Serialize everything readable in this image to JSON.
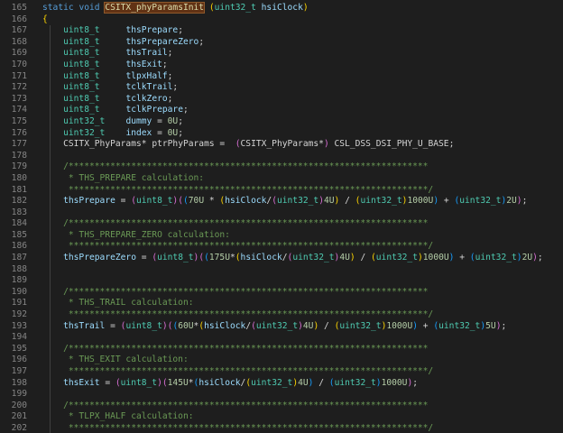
{
  "editor": {
    "lines": [
      {
        "n": "165",
        "toks": [
          {
            "t": "static",
            "c": "kw"
          },
          {
            "t": " ",
            "c": "pl"
          },
          {
            "t": "void",
            "c": "kw"
          },
          {
            "t": " ",
            "c": "pl"
          },
          {
            "t": "CSITX_phyParamsInit",
            "c": "fn",
            "hl": true
          },
          {
            "t": " ",
            "c": "pl"
          },
          {
            "t": "(",
            "c": "br"
          },
          {
            "t": "uint32_t",
            "c": "ty"
          },
          {
            "t": " ",
            "c": "pl"
          },
          {
            "t": "hsiClock",
            "c": "va"
          },
          {
            "t": ")",
            "c": "br"
          }
        ]
      },
      {
        "n": "166",
        "toks": [
          {
            "t": "{",
            "c": "br"
          }
        ]
      },
      {
        "n": "167",
        "toks": [
          {
            "t": "    ",
            "c": "pl"
          },
          {
            "t": "uint8_t",
            "c": "ty"
          },
          {
            "t": "     ",
            "c": "pl"
          },
          {
            "t": "thsPrepare",
            "c": "va"
          },
          {
            "t": ";",
            "c": "pl"
          }
        ]
      },
      {
        "n": "168",
        "toks": [
          {
            "t": "    ",
            "c": "pl"
          },
          {
            "t": "uint8_t",
            "c": "ty"
          },
          {
            "t": "     ",
            "c": "pl"
          },
          {
            "t": "thsPrepareZero",
            "c": "va"
          },
          {
            "t": ";",
            "c": "pl"
          }
        ]
      },
      {
        "n": "169",
        "toks": [
          {
            "t": "    ",
            "c": "pl"
          },
          {
            "t": "uint8_t",
            "c": "ty"
          },
          {
            "t": "     ",
            "c": "pl"
          },
          {
            "t": "thsTrail",
            "c": "va"
          },
          {
            "t": ";",
            "c": "pl"
          }
        ]
      },
      {
        "n": "170",
        "toks": [
          {
            "t": "    ",
            "c": "pl"
          },
          {
            "t": "uint8_t",
            "c": "ty"
          },
          {
            "t": "     ",
            "c": "pl"
          },
          {
            "t": "thsExit",
            "c": "va"
          },
          {
            "t": ";",
            "c": "pl"
          }
        ]
      },
      {
        "n": "171",
        "toks": [
          {
            "t": "    ",
            "c": "pl"
          },
          {
            "t": "uint8_t",
            "c": "ty"
          },
          {
            "t": "     ",
            "c": "pl"
          },
          {
            "t": "tlpxHalf",
            "c": "va"
          },
          {
            "t": ";",
            "c": "pl"
          }
        ]
      },
      {
        "n": "172",
        "toks": [
          {
            "t": "    ",
            "c": "pl"
          },
          {
            "t": "uint8_t",
            "c": "ty"
          },
          {
            "t": "     ",
            "c": "pl"
          },
          {
            "t": "tclkTrail",
            "c": "va"
          },
          {
            "t": ";",
            "c": "pl"
          }
        ]
      },
      {
        "n": "173",
        "toks": [
          {
            "t": "    ",
            "c": "pl"
          },
          {
            "t": "uint8_t",
            "c": "ty"
          },
          {
            "t": "     ",
            "c": "pl"
          },
          {
            "t": "tclkZero",
            "c": "va"
          },
          {
            "t": ";",
            "c": "pl"
          }
        ]
      },
      {
        "n": "174",
        "toks": [
          {
            "t": "    ",
            "c": "pl"
          },
          {
            "t": "uint8_t",
            "c": "ty"
          },
          {
            "t": "     ",
            "c": "pl"
          },
          {
            "t": "tclkPrepare",
            "c": "va"
          },
          {
            "t": ";",
            "c": "pl"
          }
        ]
      },
      {
        "n": "175",
        "toks": [
          {
            "t": "    ",
            "c": "pl"
          },
          {
            "t": "uint32_t",
            "c": "ty"
          },
          {
            "t": "    ",
            "c": "pl"
          },
          {
            "t": "dummy",
            "c": "va"
          },
          {
            "t": " = ",
            "c": "pl"
          },
          {
            "t": "0U",
            "c": "nu"
          },
          {
            "t": ";",
            "c": "pl"
          }
        ]
      },
      {
        "n": "176",
        "toks": [
          {
            "t": "    ",
            "c": "pl"
          },
          {
            "t": "uint32_t",
            "c": "ty"
          },
          {
            "t": "    ",
            "c": "pl"
          },
          {
            "t": "index",
            "c": "va"
          },
          {
            "t": " = ",
            "c": "pl"
          },
          {
            "t": "0U",
            "c": "nu"
          },
          {
            "t": ";",
            "c": "pl"
          }
        ]
      },
      {
        "n": "177",
        "toks": [
          {
            "t": "    ",
            "c": "pl"
          },
          {
            "t": "CSITX_PhyParams",
            "c": "pl"
          },
          {
            "t": "* ",
            "c": "pl"
          },
          {
            "t": "ptrPhyParams",
            "c": "pl"
          },
          {
            "t": " =  ",
            "c": "pl"
          },
          {
            "t": "(",
            "c": "bp"
          },
          {
            "t": "CSITX_PhyParams",
            "c": "pl"
          },
          {
            "t": "*",
            "c": "pl"
          },
          {
            "t": ")",
            "c": "bp"
          },
          {
            "t": " CSL_DSS_DSI_PHY_U_BASE;",
            "c": "pl"
          }
        ]
      },
      {
        "n": "178",
        "toks": []
      },
      {
        "n": "179",
        "toks": [
          {
            "t": "    ",
            "c": "pl"
          },
          {
            "t": "/*********************************************************************",
            "c": "cm"
          }
        ]
      },
      {
        "n": "180",
        "toks": [
          {
            "t": "     * THS_PREPARE calculation:",
            "c": "cm"
          }
        ]
      },
      {
        "n": "181",
        "toks": [
          {
            "t": "     *********************************************************************/",
            "c": "cm"
          }
        ]
      },
      {
        "n": "182",
        "toks": [
          {
            "t": "    ",
            "c": "pl"
          },
          {
            "t": "thsPrepare",
            "c": "va"
          },
          {
            "t": " = ",
            "c": "pl"
          },
          {
            "t": "(",
            "c": "bp"
          },
          {
            "t": "uint8_t",
            "c": "ty"
          },
          {
            "t": ")",
            "c": "bp"
          },
          {
            "t": "(",
            "c": "bp"
          },
          {
            "t": "(",
            "c": "bb"
          },
          {
            "t": "70U",
            "c": "nu"
          },
          {
            "t": " * ",
            "c": "pl"
          },
          {
            "t": "(",
            "c": "br"
          },
          {
            "t": "hsiClock",
            "c": "va"
          },
          {
            "t": "/",
            "c": "pl"
          },
          {
            "t": "(",
            "c": "bp"
          },
          {
            "t": "uint32_t",
            "c": "ty"
          },
          {
            "t": ")",
            "c": "bp"
          },
          {
            "t": "4U",
            "c": "nu"
          },
          {
            "t": ")",
            "c": "br"
          },
          {
            "t": " / ",
            "c": "pl"
          },
          {
            "t": "(",
            "c": "br"
          },
          {
            "t": "uint32_t",
            "c": "ty"
          },
          {
            "t": ")",
            "c": "br"
          },
          {
            "t": "1000U",
            "c": "nu"
          },
          {
            "t": ")",
            "c": "bb"
          },
          {
            "t": " + ",
            "c": "pl"
          },
          {
            "t": "(",
            "c": "bb"
          },
          {
            "t": "uint32_t",
            "c": "ty"
          },
          {
            "t": ")",
            "c": "bb"
          },
          {
            "t": "2U",
            "c": "nu"
          },
          {
            "t": ")",
            "c": "bp"
          },
          {
            "t": ";",
            "c": "pl"
          }
        ]
      },
      {
        "n": "183",
        "toks": []
      },
      {
        "n": "184",
        "toks": [
          {
            "t": "    ",
            "c": "pl"
          },
          {
            "t": "/*********************************************************************",
            "c": "cm"
          }
        ]
      },
      {
        "n": "185",
        "toks": [
          {
            "t": "     * THS_PREPARE_ZERO calculation:",
            "c": "cm"
          }
        ]
      },
      {
        "n": "186",
        "toks": [
          {
            "t": "     *********************************************************************/",
            "c": "cm"
          }
        ]
      },
      {
        "n": "187",
        "toks": [
          {
            "t": "    ",
            "c": "pl"
          },
          {
            "t": "thsPrepareZero",
            "c": "va"
          },
          {
            "t": " = ",
            "c": "pl"
          },
          {
            "t": "(",
            "c": "bp"
          },
          {
            "t": "uint8_t",
            "c": "ty"
          },
          {
            "t": ")",
            "c": "bp"
          },
          {
            "t": "(",
            "c": "bp"
          },
          {
            "t": "(",
            "c": "bb"
          },
          {
            "t": "175U",
            "c": "nu"
          },
          {
            "t": "*",
            "c": "pl"
          },
          {
            "t": "(",
            "c": "br"
          },
          {
            "t": "hsiClock",
            "c": "va"
          },
          {
            "t": "/",
            "c": "pl"
          },
          {
            "t": "(",
            "c": "bp"
          },
          {
            "t": "uint32_t",
            "c": "ty"
          },
          {
            "t": ")",
            "c": "bp"
          },
          {
            "t": "4U",
            "c": "nu"
          },
          {
            "t": ")",
            "c": "br"
          },
          {
            "t": " / ",
            "c": "pl"
          },
          {
            "t": "(",
            "c": "br"
          },
          {
            "t": "uint32_t",
            "c": "ty"
          },
          {
            "t": ")",
            "c": "br"
          },
          {
            "t": "1000U",
            "c": "nu"
          },
          {
            "t": ")",
            "c": "bb"
          },
          {
            "t": " + ",
            "c": "pl"
          },
          {
            "t": "(",
            "c": "bb"
          },
          {
            "t": "uint32_t",
            "c": "ty"
          },
          {
            "t": ")",
            "c": "bb"
          },
          {
            "t": "2U",
            "c": "nu"
          },
          {
            "t": ")",
            "c": "bp"
          },
          {
            "t": ";",
            "c": "pl"
          }
        ]
      },
      {
        "n": "188",
        "toks": []
      },
      {
        "n": "189",
        "toks": []
      },
      {
        "n": "190",
        "toks": [
          {
            "t": "    ",
            "c": "pl"
          },
          {
            "t": "/*********************************************************************",
            "c": "cm"
          }
        ]
      },
      {
        "n": "191",
        "toks": [
          {
            "t": "     * THS_TRAIL calculation:",
            "c": "cm"
          }
        ]
      },
      {
        "n": "192",
        "toks": [
          {
            "t": "     *********************************************************************/",
            "c": "cm"
          }
        ]
      },
      {
        "n": "193",
        "toks": [
          {
            "t": "    ",
            "c": "pl"
          },
          {
            "t": "thsTrail",
            "c": "va"
          },
          {
            "t": " = ",
            "c": "pl"
          },
          {
            "t": "(",
            "c": "bp"
          },
          {
            "t": "uint8_t",
            "c": "ty"
          },
          {
            "t": ")",
            "c": "bp"
          },
          {
            "t": "(",
            "c": "bp"
          },
          {
            "t": "(",
            "c": "bb"
          },
          {
            "t": "60U",
            "c": "nu"
          },
          {
            "t": "*",
            "c": "pl"
          },
          {
            "t": "(",
            "c": "br"
          },
          {
            "t": "hsiClock",
            "c": "va"
          },
          {
            "t": "/",
            "c": "pl"
          },
          {
            "t": "(",
            "c": "bp"
          },
          {
            "t": "uint32_t",
            "c": "ty"
          },
          {
            "t": ")",
            "c": "bp"
          },
          {
            "t": "4U",
            "c": "nu"
          },
          {
            "t": ")",
            "c": "br"
          },
          {
            "t": " / ",
            "c": "pl"
          },
          {
            "t": "(",
            "c": "br"
          },
          {
            "t": "uint32_t",
            "c": "ty"
          },
          {
            "t": ")",
            "c": "br"
          },
          {
            "t": "1000U",
            "c": "nu"
          },
          {
            "t": ")",
            "c": "bb"
          },
          {
            "t": " + ",
            "c": "pl"
          },
          {
            "t": "(",
            "c": "bb"
          },
          {
            "t": "uint32_t",
            "c": "ty"
          },
          {
            "t": ")",
            "c": "bb"
          },
          {
            "t": "5U",
            "c": "nu"
          },
          {
            "t": ")",
            "c": "bp"
          },
          {
            "t": ";",
            "c": "pl"
          }
        ]
      },
      {
        "n": "194",
        "toks": []
      },
      {
        "n": "195",
        "toks": [
          {
            "t": "    ",
            "c": "pl"
          },
          {
            "t": "/*********************************************************************",
            "c": "cm"
          }
        ]
      },
      {
        "n": "196",
        "toks": [
          {
            "t": "     * THS_EXIT calculation:",
            "c": "cm"
          }
        ]
      },
      {
        "n": "197",
        "toks": [
          {
            "t": "     *********************************************************************/",
            "c": "cm"
          }
        ]
      },
      {
        "n": "198",
        "toks": [
          {
            "t": "    ",
            "c": "pl"
          },
          {
            "t": "thsExit",
            "c": "va"
          },
          {
            "t": " = ",
            "c": "pl"
          },
          {
            "t": "(",
            "c": "bp"
          },
          {
            "t": "uint8_t",
            "c": "ty"
          },
          {
            "t": ")",
            "c": "bp"
          },
          {
            "t": "(",
            "c": "bp"
          },
          {
            "t": "145U",
            "c": "nu"
          },
          {
            "t": "*",
            "c": "pl"
          },
          {
            "t": "(",
            "c": "bb"
          },
          {
            "t": "hsiClock",
            "c": "va"
          },
          {
            "t": "/",
            "c": "pl"
          },
          {
            "t": "(",
            "c": "br"
          },
          {
            "t": "uint32_t",
            "c": "ty"
          },
          {
            "t": ")",
            "c": "br"
          },
          {
            "t": "4U",
            "c": "nu"
          },
          {
            "t": ")",
            "c": "bb"
          },
          {
            "t": " / ",
            "c": "pl"
          },
          {
            "t": "(",
            "c": "bb"
          },
          {
            "t": "uint32_t",
            "c": "ty"
          },
          {
            "t": ")",
            "c": "bb"
          },
          {
            "t": "1000U",
            "c": "nu"
          },
          {
            "t": ")",
            "c": "bp"
          },
          {
            "t": ";",
            "c": "pl"
          }
        ]
      },
      {
        "n": "199",
        "toks": []
      },
      {
        "n": "200",
        "toks": [
          {
            "t": "    ",
            "c": "pl"
          },
          {
            "t": "/*********************************************************************",
            "c": "cm"
          }
        ]
      },
      {
        "n": "201",
        "toks": [
          {
            "t": "     * TLPX_HALF calculation:",
            "c": "cm"
          }
        ]
      },
      {
        "n": "202",
        "toks": [
          {
            "t": "     *********************************************************************/",
            "c": "cm"
          }
        ]
      }
    ]
  }
}
